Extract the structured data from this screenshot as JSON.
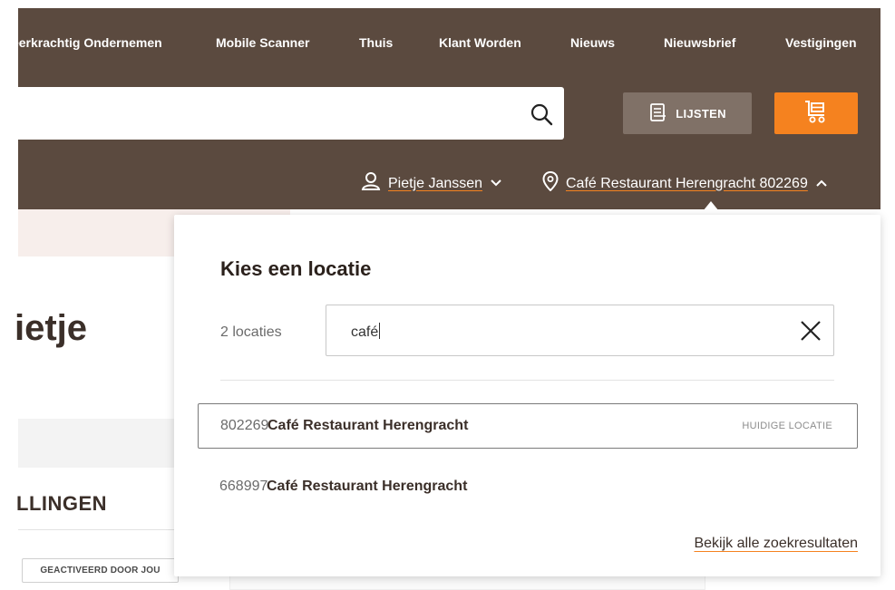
{
  "nav": {
    "items": [
      "Weerkrachtig Ondernemen",
      "Mobile Scanner",
      "Thuis",
      "Klant Worden",
      "Nieuws",
      "Nieuwsbrief",
      "Vestigingen"
    ]
  },
  "header": {
    "lists_label": "LIJSTEN",
    "user_name": "Pietje Janssen",
    "current_location": "Café Restaurant Herengracht 802269"
  },
  "background": {
    "greeting_fragment": "ietje",
    "section_title": "LLINGEN",
    "badge": "GEACTIVEERD DOOR JOU"
  },
  "popup": {
    "title": "Kies een locatie",
    "count": "2 locaties",
    "search_value": "café",
    "results": [
      {
        "number": "802269",
        "name": "Café Restaurant Herengracht",
        "tag": "HUIDIGE LOCATIE"
      },
      {
        "number": "668997",
        "name": "Café Restaurant Herengracht",
        "tag": ""
      }
    ],
    "all_results_link": "Bekijk alle zoekresultaten"
  },
  "colors": {
    "header_brown": "#5b4a3f",
    "accent_orange": "#f5821f",
    "lists_button": "#807167"
  }
}
